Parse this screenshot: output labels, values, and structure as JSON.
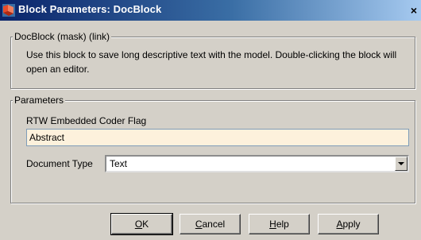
{
  "window": {
    "title": "Block Parameters: DocBlock",
    "close_glyph": "×"
  },
  "mask_group": {
    "legend": "DocBlock (mask) (link)",
    "description": "Use this block to save long descriptive text with the model.  Double-clicking the block will open an editor."
  },
  "params_group": {
    "legend": "Parameters",
    "rtw_label": "RTW Embedded Coder Flag",
    "rtw_value": "Abstract",
    "doc_type_label": "Document Type",
    "doc_type_value": "Text"
  },
  "buttons": {
    "ok": {
      "mnemonic": "O",
      "rest": "K"
    },
    "cancel": {
      "mnemonic": "C",
      "rest": "ancel"
    },
    "help": {
      "mnemonic": "H",
      "rest": "elp"
    },
    "apply": {
      "mnemonic": "A",
      "rest": "pply"
    }
  },
  "icons": {
    "title_icon": "simulink-block-icon",
    "dropdown": "chevron-down-icon"
  },
  "colors": {
    "titlebar_start": "#0a246a",
    "titlebar_end": "#a6caf0",
    "dialog_bg": "#d4d0c8",
    "field_bg": "#fdf1dc"
  }
}
